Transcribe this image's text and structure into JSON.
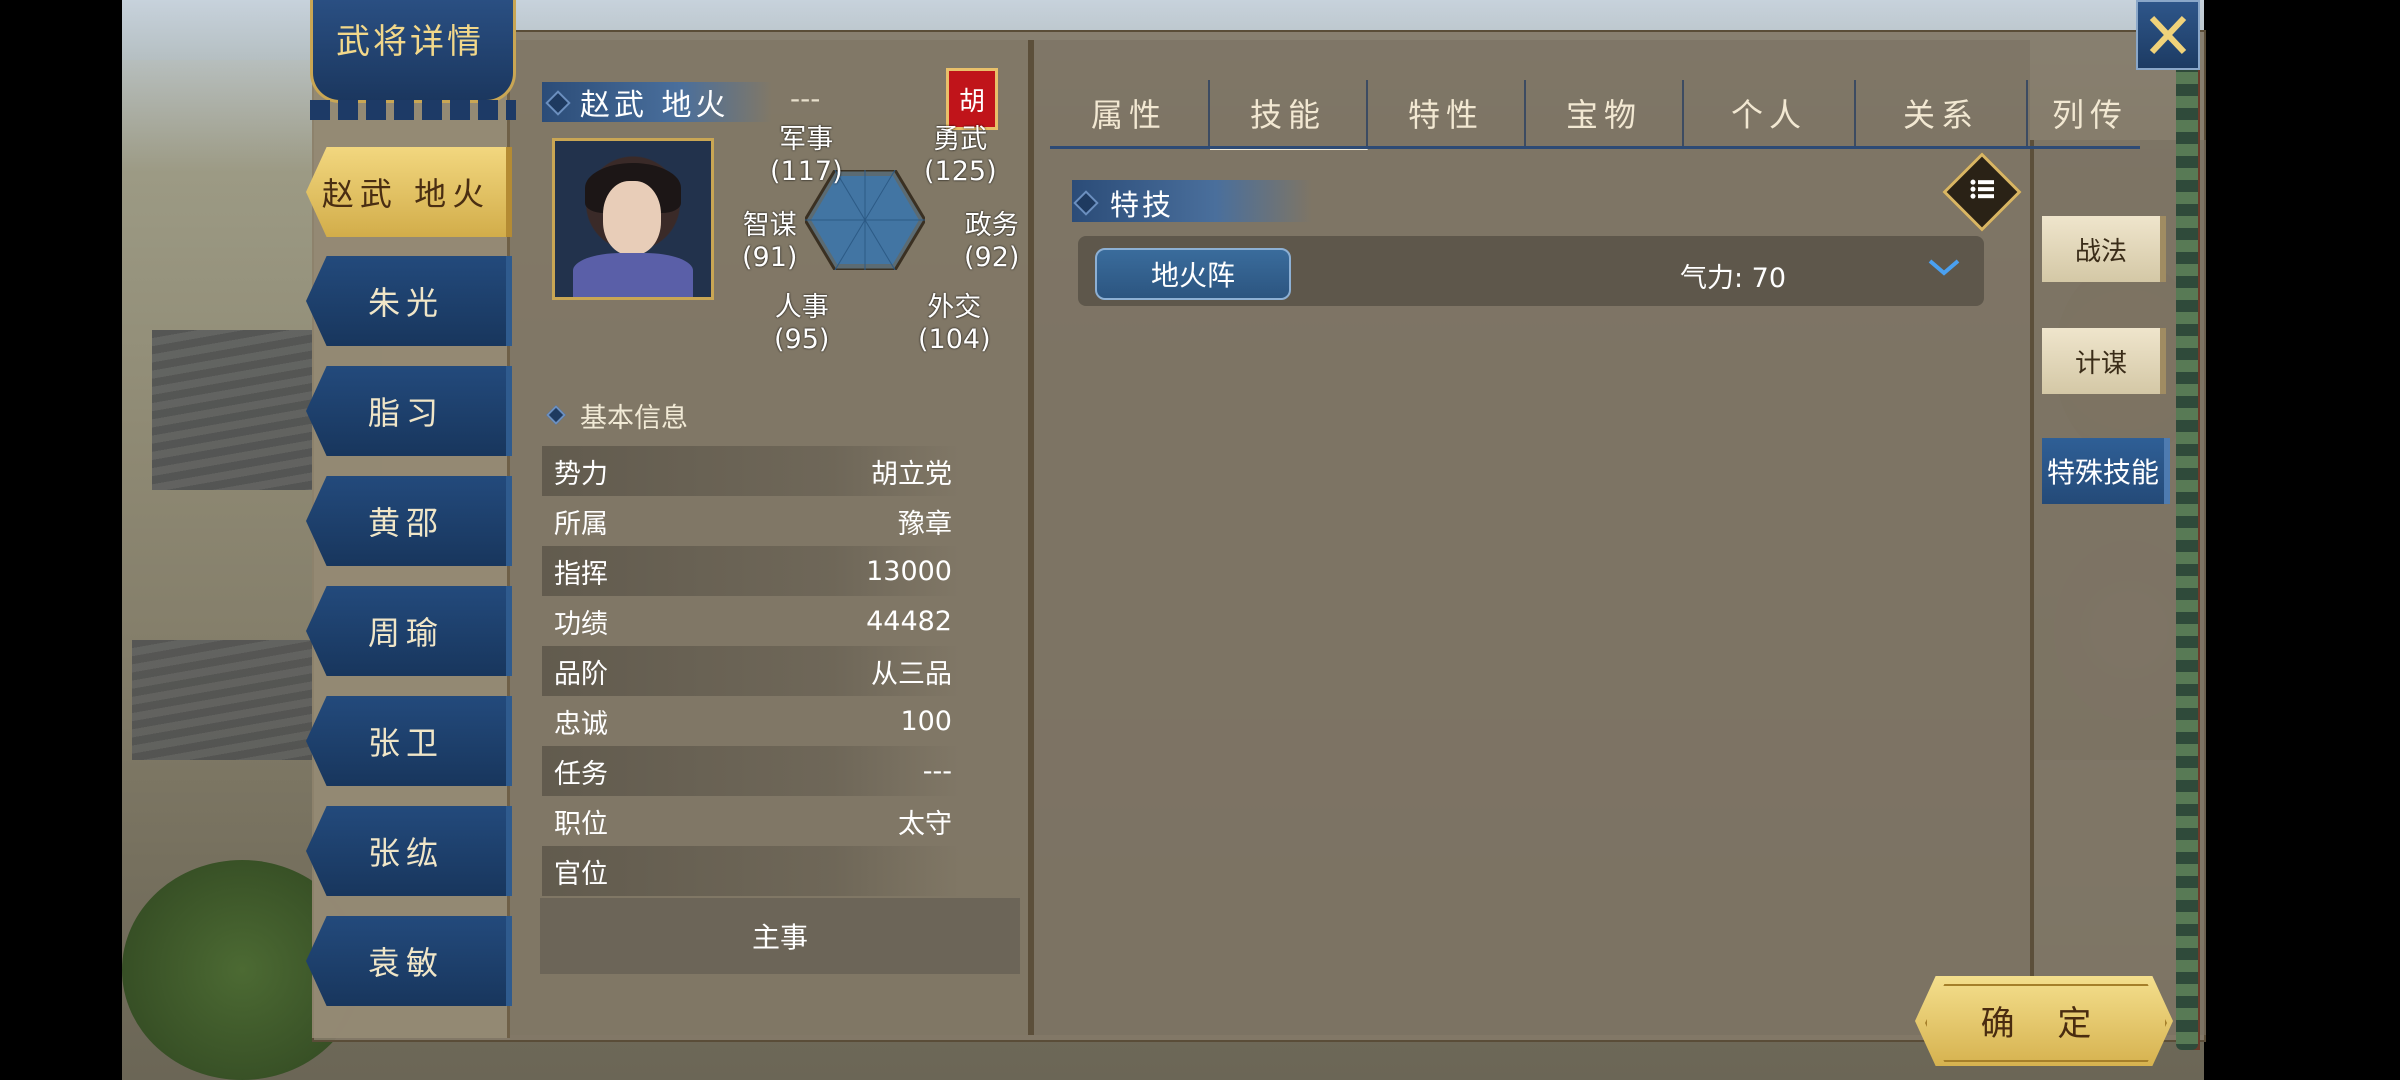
{
  "window": {
    "title": "武将详情"
  },
  "colors": {
    "accent_blue": "#244a78",
    "accent_gold": "#d6b24f",
    "panel": "#837a68",
    "seal_red": "#c0141a"
  },
  "officer_list": [
    {
      "name": "赵武 地火",
      "active": true
    },
    {
      "name": "朱光",
      "active": false
    },
    {
      "name": "脂习",
      "active": false
    },
    {
      "name": "黄邵",
      "active": false
    },
    {
      "name": "周瑜",
      "active": false
    },
    {
      "name": "张卫",
      "active": false
    },
    {
      "name": "张纮",
      "active": false
    },
    {
      "name": "袁敏",
      "active": false
    }
  ],
  "officer": {
    "name": "赵武 地火",
    "title_value": "---",
    "faction_seal": "胡",
    "stats": {
      "military": {
        "label": "军事",
        "value": "(117)"
      },
      "valor": {
        "label": "勇武",
        "value": "(125)"
      },
      "intellect": {
        "label": "智谋",
        "value": "(91)"
      },
      "politics": {
        "label": "政务",
        "value": "(92)"
      },
      "personnel": {
        "label": "人事",
        "value": "(95)"
      },
      "diplomacy": {
        "label": "外交",
        "value": "(104)"
      }
    }
  },
  "basic_info": {
    "heading": "基本信息",
    "rows": [
      {
        "label": "势力",
        "value": "胡立党"
      },
      {
        "label": "所属",
        "value": "豫章"
      },
      {
        "label": "指挥",
        "value": "13000"
      },
      {
        "label": "功绩",
        "value": "44482"
      },
      {
        "label": "品阶",
        "value": "从三品"
      },
      {
        "label": "忠诚",
        "value": "100"
      },
      {
        "label": "任务",
        "value": "---"
      },
      {
        "label": "职位",
        "value": "太守"
      },
      {
        "label": "官位",
        "value": ""
      }
    ],
    "footer": "主事"
  },
  "tabs": [
    "属性",
    "技能",
    "特性",
    "宝物",
    "个人",
    "关系",
    "列传"
  ],
  "active_tab": "技能",
  "skills": {
    "section_title": "特技",
    "items": [
      {
        "name": "地火阵",
        "cost_text": "气力: 70"
      }
    ]
  },
  "side_tabs": [
    {
      "label": "战法",
      "active": false
    },
    {
      "label": "计谋",
      "active": false
    },
    {
      "label": "特殊技能",
      "active": true
    }
  ],
  "buttons": {
    "confirm": "确 定"
  },
  "icons": [
    "close-icon",
    "list-menu-icon",
    "chevron-down-icon",
    "faction-seal-icon"
  ]
}
